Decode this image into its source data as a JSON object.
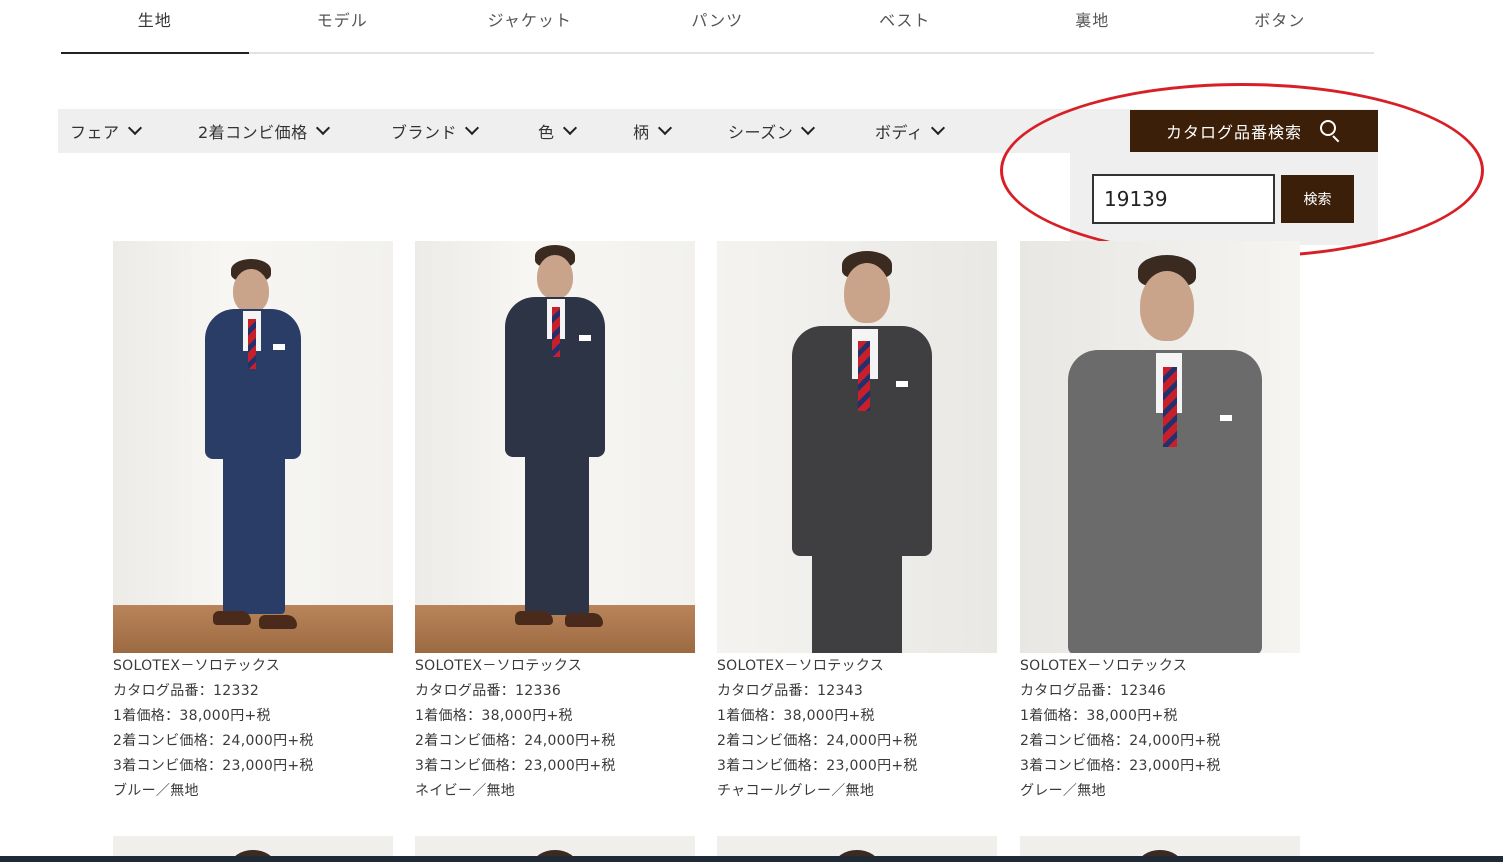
{
  "tabs": [
    {
      "label": "生地",
      "active": true
    },
    {
      "label": "モデル"
    },
    {
      "label": "ジャケット"
    },
    {
      "label": "パンツ"
    },
    {
      "label": "ベスト"
    },
    {
      "label": "裏地"
    },
    {
      "label": "ボタン"
    }
  ],
  "filters": [
    "フェア",
    "2着コンビ価格",
    "ブランド",
    "色",
    "柄",
    "シーズン",
    "ボディ"
  ],
  "catalog_search": {
    "button_label": "カタログ品番検索",
    "input_value": "19139",
    "submit_label": "検索"
  },
  "products": [
    {
      "brand": "SOLOTEX－ソロテックス",
      "catalog": "カタログ品番：12332",
      "price1": "1着価格：38,000円+税",
      "price2": "2着コンビ価格：24,000円+税",
      "price3": "3着コンビ価格：23,000円+税",
      "color": "ブルー／無地",
      "suit_color": "#2a3d66"
    },
    {
      "brand": "SOLOTEX－ソロテックス",
      "catalog": "カタログ品番：12336",
      "price1": "1着価格：38,000円+税",
      "price2": "2着コンビ価格：24,000円+税",
      "price3": "3着コンビ価格：23,000円+税",
      "color": "ネイビー／無地",
      "suit_color": "#2c3446"
    },
    {
      "brand": "SOLOTEX－ソロテックス",
      "catalog": "カタログ品番：12343",
      "price1": "1着価格：38,000円+税",
      "price2": "2着コンビ価格：24,000円+税",
      "price3": "3着コンビ価格：23,000円+税",
      "color": "チャコールグレー／無地",
      "suit_color": "#3f3f41"
    },
    {
      "brand": "SOLOTEX－ソロテックス",
      "catalog": "カタログ品番：12346",
      "price1": "1着価格：38,000円+税",
      "price2": "2着コンビ価格：24,000円+税",
      "price3": "3着コンビ価格：23,000円+税",
      "color": "グレー／無地",
      "suit_color": "#6b6b6c"
    }
  ],
  "colors": {
    "accent_brown": "#3c1f08",
    "highlight_red": "#d81f26",
    "filter_bg": "#efefef"
  }
}
